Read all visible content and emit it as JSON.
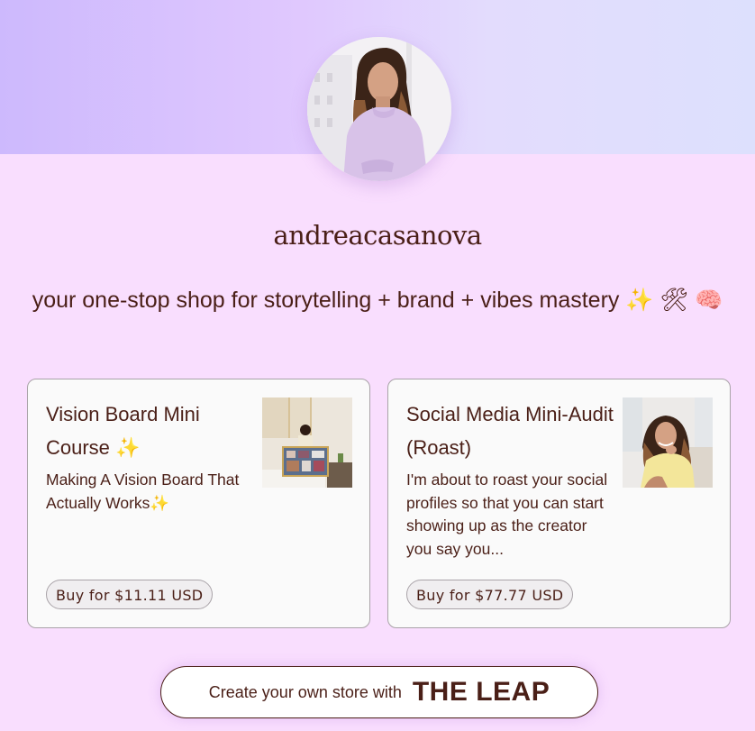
{
  "profile": {
    "username": "andreacasanova",
    "avatar_alt": "profile photo of woman in lavender sweater",
    "tagline": "your one-stop shop for storytelling + brand + vibes mastery",
    "tagline_emojis": [
      "✨",
      "🛠",
      "🧠"
    ]
  },
  "products": [
    {
      "title": "Vision Board Mini Course",
      "title_emoji": "✨",
      "description": "Making A Vision Board That Actually Works",
      "description_emoji": "✨",
      "buy_label": "Buy for $11.11 USD",
      "thumbnail": "woman holding a vision board collage"
    },
    {
      "title": "Social Media Mini-Audit (Roast)",
      "title_emoji": "",
      "description": "I'm about to roast your social profiles so that you can start showing up as the creator you say you...",
      "description_emoji": "",
      "buy_label": "Buy for $77.77 USD",
      "thumbnail": "smiling woman in yellow sweater"
    }
  ],
  "footer": {
    "cta_text": "Create your own store with",
    "brand": "THE LEAP"
  },
  "colors": {
    "text": "#4a1f17",
    "background": "#f9defe",
    "banner_start": "#cdb9fd",
    "banner_end": "#dde0fd",
    "card_bg": "#fafafa",
    "card_border": "#a9a3a8"
  }
}
